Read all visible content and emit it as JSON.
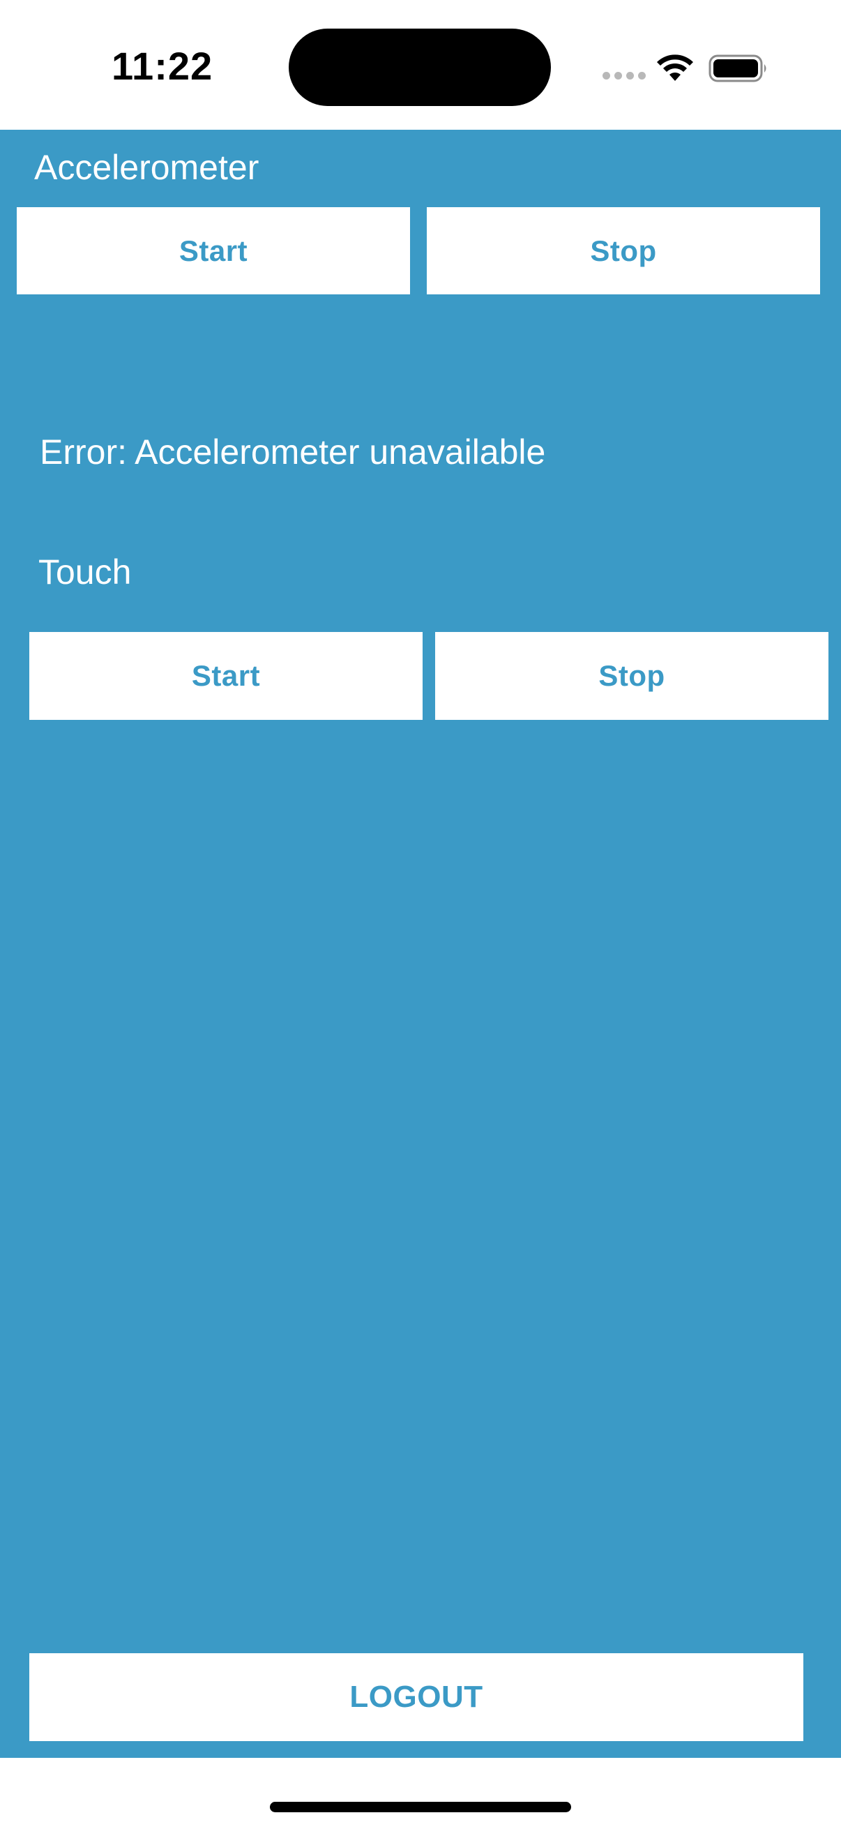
{
  "status_bar": {
    "time": "11:22"
  },
  "accelerometer": {
    "title": "Accelerometer",
    "start_label": "Start",
    "stop_label": "Stop",
    "error": "Error: Accelerometer unavailable"
  },
  "touch": {
    "title": "Touch",
    "start_label": "Start",
    "stop_label": "Stop"
  },
  "logout_label": "LOGOUT",
  "colors": {
    "background": "#3b9ac6",
    "button_bg": "#ffffff",
    "button_text": "#3b9ac6",
    "label_text": "#ffffff"
  },
  "icons": [
    "signal-dots-icon",
    "wifi-icon",
    "battery-icon"
  ]
}
